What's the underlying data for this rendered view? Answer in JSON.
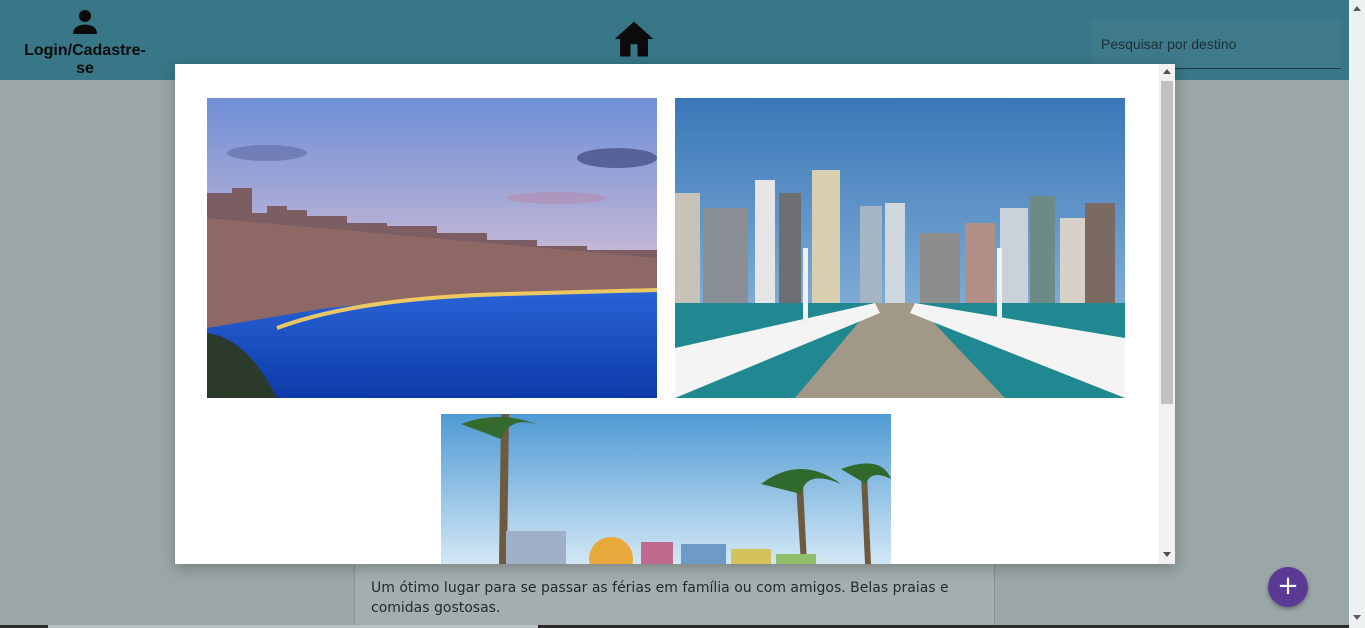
{
  "header": {
    "login_label": "Login/Cadastre-se",
    "search_placeholder": "Pesquisar por destino",
    "icons": {
      "login": "person-icon",
      "home": "home-icon"
    },
    "bar_color": "#377787"
  },
  "card": {
    "description": "Um ótimo lugar para se passar as férias em família ou com amigos. Belas praias e comidas gostosas."
  },
  "fab": {
    "label": "+",
    "color": "#5a3a94"
  },
  "modal": {
    "gallery": [
      {
        "name": "city-beach-night-photo",
        "scene": "city skyline with lit bay at dusk"
      },
      {
        "name": "pier-skyline-photo",
        "scene": "white pier leading to skyline"
      },
      {
        "name": "beach-sign-palms-photo",
        "scene": "palm trees and colorful letter sign"
      }
    ]
  }
}
